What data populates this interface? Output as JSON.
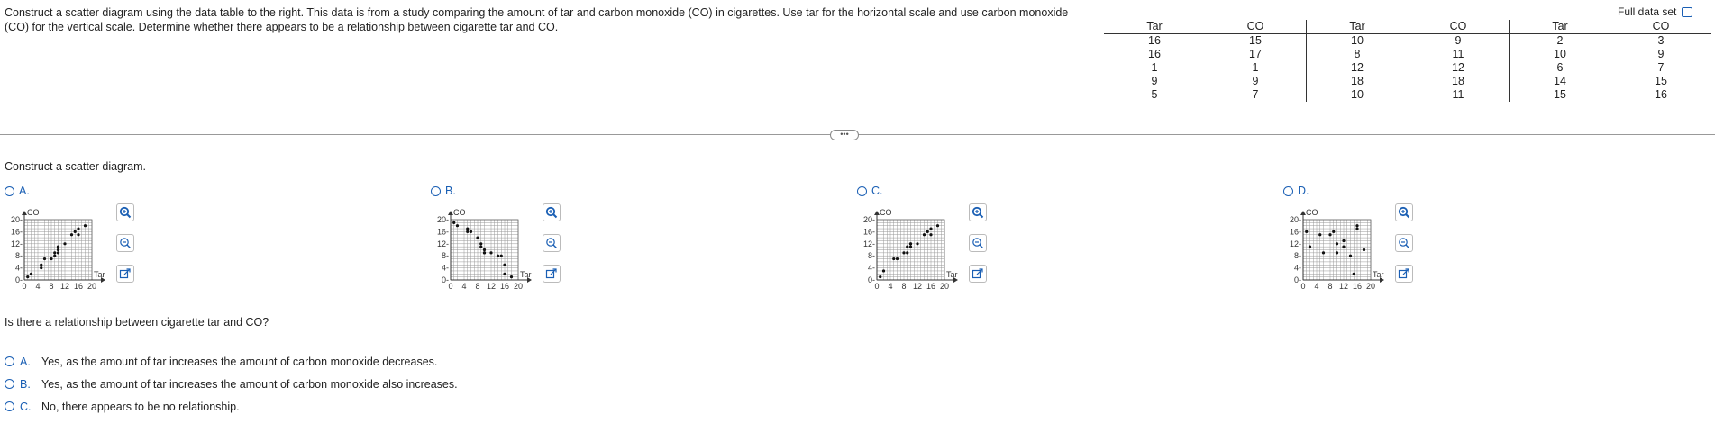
{
  "question_text": "Construct a scatter diagram using the data table to the right. This data is from a study comparing the amount of tar and carbon monoxide (CO) in cigarettes. Use tar for the horizontal scale and use carbon monoxide (CO) for the vertical scale. Determine whether there appears to be a relationship between cigarette tar and CO.",
  "full_data_set_label": "Full data set",
  "table": {
    "headers": [
      "Tar",
      "CO",
      "Tar",
      "CO",
      "Tar",
      "CO"
    ],
    "rows": [
      [
        "16",
        "15",
        "10",
        "9",
        "2",
        "3"
      ],
      [
        "16",
        "17",
        "8",
        "11",
        "10",
        "9"
      ],
      [
        "1",
        "1",
        "12",
        "12",
        "6",
        "7"
      ],
      [
        "9",
        "9",
        "18",
        "18",
        "14",
        "15"
      ],
      [
        "5",
        "7",
        "10",
        "11",
        "15",
        "16"
      ]
    ]
  },
  "more_button": "•••",
  "construct_label": "Construct a scatter diagram.",
  "plot_axes": {
    "y_label": "CO",
    "x_label": "Tar",
    "y_ticks": [
      "20",
      "16",
      "12",
      "8",
      "4",
      "0"
    ],
    "x_ticks": [
      "0",
      "4",
      "8",
      "12",
      "16",
      "20"
    ]
  },
  "options": [
    {
      "label": "A."
    },
    {
      "label": "B."
    },
    {
      "label": "C."
    },
    {
      "label": "D."
    }
  ],
  "chart_data": [
    {
      "type": "scatter",
      "x": [
        1,
        2,
        5,
        5,
        6,
        8,
        9,
        9,
        10,
        10,
        10,
        12,
        14,
        15,
        16,
        16,
        18
      ],
      "y": [
        1,
        2,
        4,
        5,
        7,
        7,
        9,
        8,
        10,
        11,
        9,
        12,
        15,
        16,
        15,
        17,
        18
      ],
      "xlim": [
        0,
        20
      ],
      "ylim": [
        0,
        20
      ],
      "xlabel": "Tar",
      "ylabel": "CO"
    },
    {
      "type": "scatter",
      "x": [
        1,
        2,
        5,
        5,
        6,
        8,
        9,
        9,
        10,
        10,
        10,
        12,
        14,
        15,
        16,
        16,
        18
      ],
      "y": [
        19,
        18,
        17,
        16,
        16,
        14,
        12,
        11,
        10,
        9,
        9,
        9,
        8,
        8,
        5,
        2,
        1
      ],
      "xlim": [
        0,
        20
      ],
      "ylim": [
        0,
        20
      ],
      "xlabel": "Tar",
      "ylabel": "CO"
    },
    {
      "type": "scatter",
      "x": [
        1,
        2,
        5,
        6,
        8,
        9,
        9,
        10,
        10,
        10,
        12,
        14,
        15,
        16,
        16,
        18
      ],
      "y": [
        1,
        3,
        7,
        7,
        9,
        9,
        11,
        12,
        12,
        11,
        12,
        15,
        16,
        15,
        17,
        18
      ],
      "xlim": [
        0,
        20
      ],
      "ylim": [
        0,
        20
      ],
      "xlabel": "Tar",
      "ylabel": "CO"
    },
    {
      "type": "scatter",
      "x": [
        1,
        2,
        5,
        6,
        8,
        9,
        10,
        10,
        12,
        12,
        14,
        15,
        16,
        16,
        18
      ],
      "y": [
        16,
        11,
        15,
        9,
        15,
        16,
        9,
        12,
        11,
        13,
        8,
        2,
        18,
        17,
        10
      ],
      "xlim": [
        0,
        20
      ],
      "ylim": [
        0,
        20
      ],
      "xlabel": "Tar",
      "ylabel": "CO"
    }
  ],
  "relationship_question": "Is there a relationship between cigarette tar and CO?",
  "answers": [
    {
      "letter": "A.",
      "text": "Yes, as the amount of tar increases the amount of carbon monoxide decreases."
    },
    {
      "letter": "B.",
      "text": "Yes, as the amount of tar increases the amount of carbon monoxide also increases."
    },
    {
      "letter": "C.",
      "text": "No, there appears to be no relationship."
    }
  ],
  "colors": {
    "accent": "#1a5fb4",
    "grid": "#888888",
    "text": "#222222"
  }
}
